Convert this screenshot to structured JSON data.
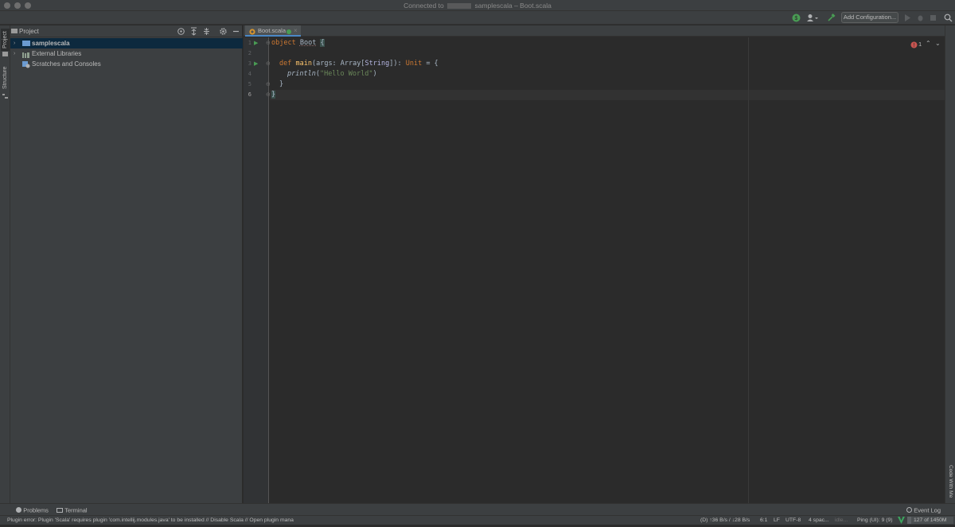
{
  "window": {
    "title_prefix": "Connected to",
    "title_suffix": "samplescala – Boot.scala"
  },
  "toolbar": {
    "add_config_label": "Add Configuration..."
  },
  "stripes": {
    "project_tab": "Project",
    "structure_tab": "Structure",
    "code_with_me_tab": "Code With Me"
  },
  "project": {
    "header_label": "Project",
    "tree": [
      {
        "label": "samplescala",
        "selected": true
      },
      {
        "label": "External Libraries",
        "selected": false
      },
      {
        "label": "Scratches and Consoles",
        "selected": false
      }
    ]
  },
  "editor": {
    "tab_label": "Boot.scala",
    "line_numbers": [
      "1",
      "2",
      "3",
      "4",
      "5",
      "6"
    ],
    "error_count": "1",
    "code": {
      "l1_kw": "object",
      "l1_name": "Boot",
      "l1_brace": "{",
      "l3_kw": "def",
      "l3_fn": "main",
      "l3_args": "(args: ",
      "l3_type1": "Array",
      "l3_b1": "[",
      "l3_type2": "String",
      "l3_b2": "]): ",
      "l3_type3": "Unit",
      "l3_end": " = {",
      "l4_fn": "println",
      "l4_open": "(",
      "l4_str": "\"Hello World\"",
      "l4_close": ")",
      "l5": "}",
      "l6": "}"
    }
  },
  "bottom": {
    "problems_label": "Problems",
    "terminal_label": "Terminal",
    "event_log_label": "Event Log"
  },
  "status": {
    "message": "Plugin error: Plugin 'Scala' requires plugin 'com.intellij.modules.java' to be installed // Disable Scala // Open plugin mana",
    "network": "(D) ↑36 B/s / ↓28 B/s",
    "position": "6:1",
    "line_sep": "LF",
    "encoding": "UTF-8",
    "indent": "4 spac...",
    "idle": "idle...",
    "ping": "Ping (UI): 9 (9)",
    "memory": "127 of 1450M"
  },
  "colors": {
    "accent_blue": "#4a88c7",
    "selection": "#0d293e",
    "run_green": "#499c54",
    "error_red": "#c75450"
  }
}
